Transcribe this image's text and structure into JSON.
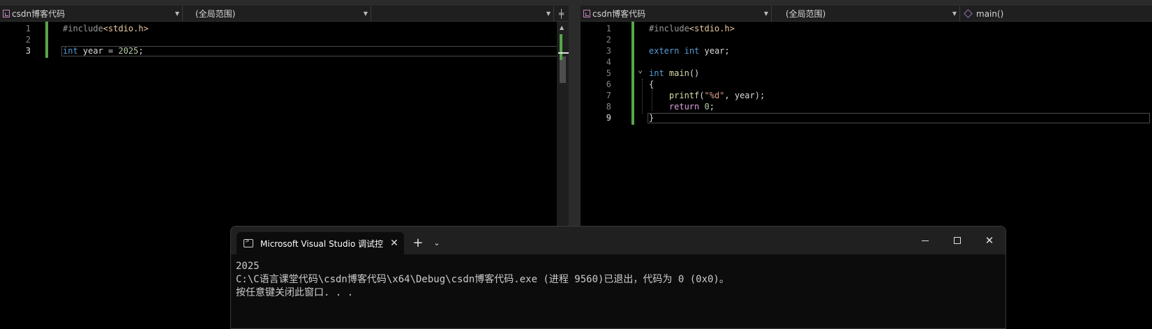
{
  "left_editor": {
    "navbar": {
      "project": "csdn博客代码",
      "scope": "(全局范围)",
      "member": ""
    },
    "lines": [
      {
        "num": "1",
        "tokens": [
          {
            "t": "#include",
            "c": "pp"
          },
          {
            "t": "<stdio.h>",
            "c": "inc"
          }
        ]
      },
      {
        "num": "2",
        "tokens": []
      },
      {
        "num": "3",
        "tokens": [
          {
            "t": "int",
            "c": "kw"
          },
          {
            "t": " year = ",
            "c": ""
          },
          {
            "t": "2025",
            "c": "num"
          },
          {
            "t": ";",
            "c": ""
          }
        ]
      }
    ],
    "current_line": "3"
  },
  "right_editor": {
    "navbar": {
      "project": "csdn博客代码",
      "scope": "(全局范围)",
      "member": "main()"
    },
    "lines": [
      {
        "num": "1",
        "tokens": [
          {
            "t": "#include",
            "c": "pp"
          },
          {
            "t": "<stdio.h>",
            "c": "inc"
          }
        ]
      },
      {
        "num": "2",
        "tokens": []
      },
      {
        "num": "3",
        "tokens": [
          {
            "t": "extern",
            "c": "kw"
          },
          {
            "t": " ",
            "c": ""
          },
          {
            "t": "int",
            "c": "kw"
          },
          {
            "t": " year;",
            "c": ""
          }
        ]
      },
      {
        "num": "4",
        "tokens": []
      },
      {
        "num": "5",
        "tokens": [
          {
            "t": "int",
            "c": "kw"
          },
          {
            "t": " ",
            "c": ""
          },
          {
            "t": "main",
            "c": "fn"
          },
          {
            "t": "()",
            "c": ""
          }
        ]
      },
      {
        "num": "6",
        "tokens": [
          {
            "t": "{",
            "c": ""
          }
        ]
      },
      {
        "num": "7",
        "tokens": [
          {
            "t": "    ",
            "c": ""
          },
          {
            "t": "printf",
            "c": "fn"
          },
          {
            "t": "(",
            "c": ""
          },
          {
            "t": "\"%d\"",
            "c": "str"
          },
          {
            "t": ", year);",
            "c": ""
          }
        ]
      },
      {
        "num": "8",
        "tokens": [
          {
            "t": "    ",
            "c": ""
          },
          {
            "t": "return",
            "c": "ctl"
          },
          {
            "t": " ",
            "c": ""
          },
          {
            "t": "0",
            "c": "num"
          },
          {
            "t": ";",
            "c": ""
          }
        ]
      },
      {
        "num": "9",
        "tokens": [
          {
            "t": "}",
            "c": ""
          }
        ]
      }
    ],
    "current_line": "9"
  },
  "console": {
    "tab_title": "Microsoft Visual Studio 调试控",
    "output": [
      "2025",
      "C:\\C语言课堂代码\\csdn博客代码\\x64\\Debug\\csdn博客代码.exe (进程 9560)已退出，代码为 0 (0x0)。",
      "按任意键关闭此窗口. . ."
    ]
  },
  "colors": {
    "editor_bg": "#000000",
    "keyword": "#569cd6",
    "string": "#d69d85",
    "change_bar": "#57a64a"
  }
}
